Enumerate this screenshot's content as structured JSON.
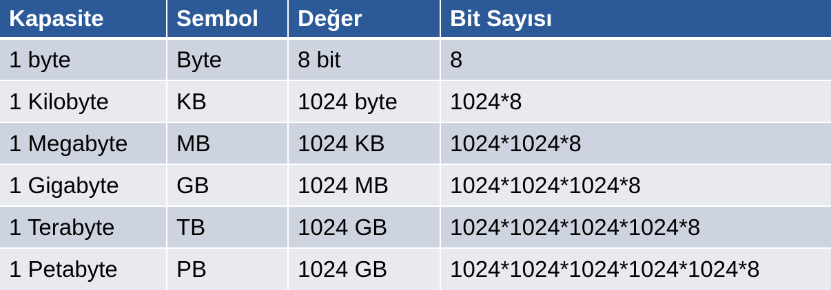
{
  "table": {
    "headers": [
      "Kapasite",
      "Sembol",
      "Değer",
      "Bit Sayısı"
    ],
    "rows": [
      [
        "1 byte",
        "Byte",
        "8 bit",
        "8"
      ],
      [
        "1 Kilobyte",
        "KB",
        "1024 byte",
        "1024*8"
      ],
      [
        "1 Megabyte",
        "MB",
        "1024 KB",
        "1024*1024*8"
      ],
      [
        "1 Gigabyte",
        "GB",
        "1024 MB",
        "1024*1024*1024*8"
      ],
      [
        "1 Terabyte",
        "TB",
        "1024 GB",
        "1024*1024*1024*1024*8"
      ],
      [
        "1 Petabyte",
        "PB",
        "1024 GB",
        "1024*1024*1024*1024*1024*8"
      ]
    ]
  },
  "colors": {
    "header_background": "#2c5a98",
    "header_text": "#ffffff",
    "row_odd_background": "#cdd3df",
    "row_even_background": "#e8eaef"
  }
}
